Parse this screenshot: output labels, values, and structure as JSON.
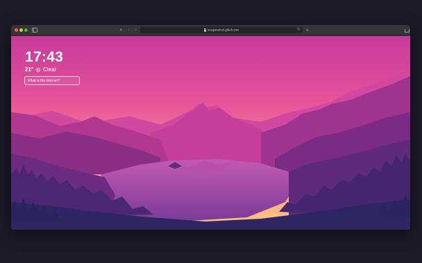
{
  "browser": {
    "address_url": "scapewind.glitch.me",
    "toolbar_icons": [
      "sidebar-icon",
      "shield-icon",
      "back-icon",
      "forward-icon",
      "lock-icon",
      "reload-icon",
      "plus-icon",
      "share-icon",
      "tabs-icon"
    ]
  },
  "page": {
    "time": "17:43",
    "weather": {
      "temperature": "21°",
      "condition": "Clear",
      "icon": "sun-icon"
    },
    "search": {
      "placeholder": "What is the internet?"
    }
  },
  "colors": {
    "sky_top": "#d8409a",
    "sky_horizon": "#ffb37c",
    "mountains_near": "#2e2563",
    "lake": "#8a3f98"
  }
}
